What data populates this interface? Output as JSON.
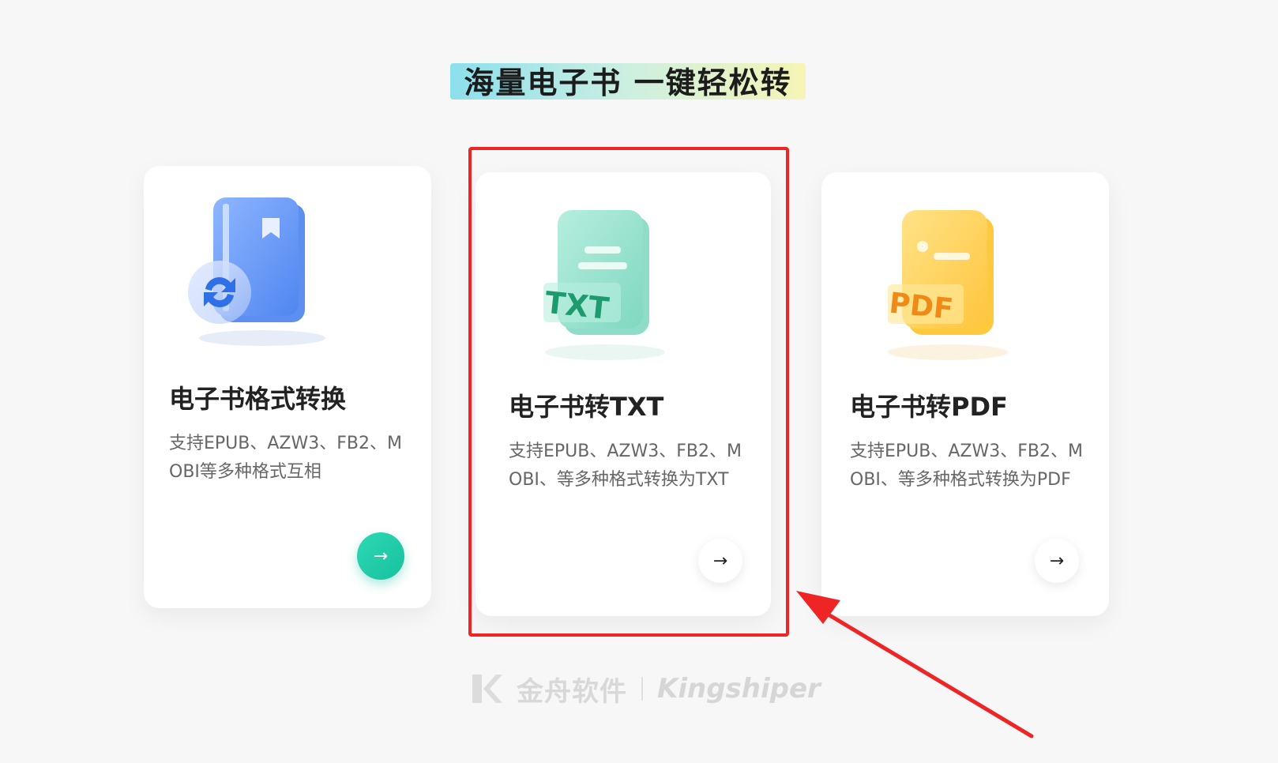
{
  "headline": {
    "text": "海量电子书  一键轻松转"
  },
  "cards": [
    {
      "title": "电子书格式转换",
      "description": "支持EPUB、AZW3、FB2、MOBI等多种格式互相",
      "icon": "ebook-convert-icon",
      "arrow": "→",
      "accent": "#17c19d"
    },
    {
      "title": "电子书转TXT",
      "description": "支持EPUB、AZW3、FB2、MOBI、等多种格式转换为TXT",
      "icon": "txt-file-icon",
      "icon_text": "TXT",
      "arrow": "→",
      "accent": "#8fe0cc"
    },
    {
      "title": "电子书转PDF",
      "description": "支持EPUB、AZW3、FB2、MOBI、等多种格式转换为PDF",
      "icon": "pdf-file-icon",
      "icon_text": "PDF",
      "arrow": "→",
      "accent": "#ffc53d"
    }
  ],
  "annotation": {
    "highlight_color": "#ef2525"
  },
  "watermark": {
    "brand_cn": "金舟软件",
    "brand_en": "Kingshiper"
  }
}
